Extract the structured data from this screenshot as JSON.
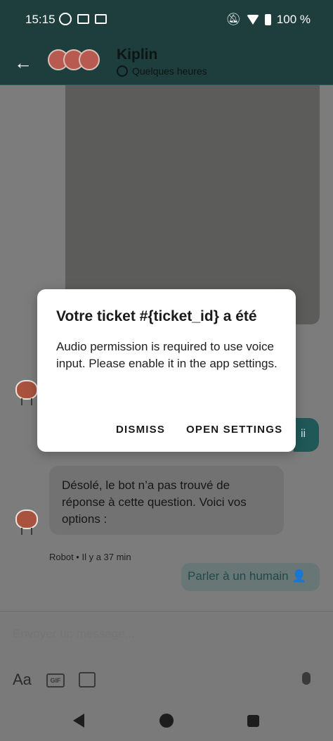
{
  "status_bar": {
    "time": "15:15",
    "battery": "100 %",
    "icons": [
      "face-icon",
      "sim-icon",
      "sim-icon",
      "mute-icon",
      "wifi-icon",
      "battery-icon"
    ]
  },
  "header": {
    "title": "Kiplin",
    "subtitle": "Quelques heures",
    "back_icon": "arrow-left-icon",
    "subtitle_icon": "clock-icon"
  },
  "messages": {
    "partial_user_text": "ii",
    "bot_message": "Désolé, le bot n’a pas trouvé de réponse à cette question. Voici vos options :",
    "bot_meta": "Robot • Il y a 37 min",
    "quick_reply": "Parler à un humain 👤"
  },
  "composer": {
    "placeholder": "Envoyer un message...",
    "format_label": "Aa",
    "gif_label": "GIF"
  },
  "dialog": {
    "title": "Votre ticket #{ticket_id} a été",
    "body": "Audio permission is required to use voice input. Please enable it in the app settings.",
    "dismiss_label": "DISMISS",
    "open_settings_label": "OPEN SETTINGS"
  },
  "colors": {
    "header_bg": "#1e3d3d",
    "scrim_bg": "#7c7c7c",
    "dialog_bg": "#ffffff"
  }
}
